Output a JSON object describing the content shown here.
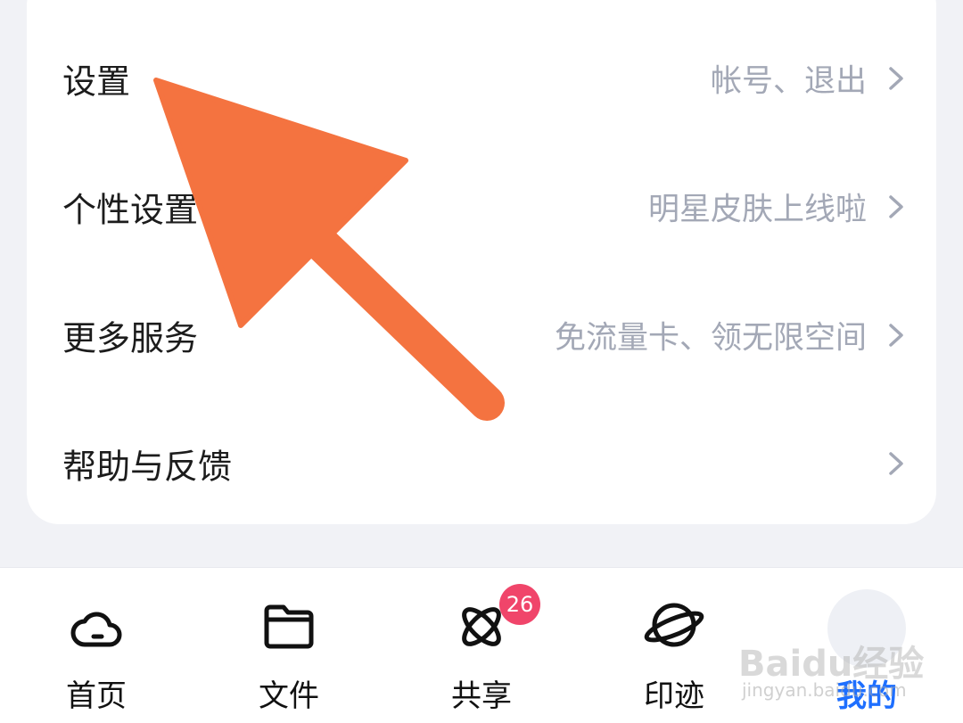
{
  "menu": {
    "items": [
      {
        "label": "设置",
        "hint": "帐号、退出"
      },
      {
        "label": "个性设置",
        "hint": "明星皮肤上线啦"
      },
      {
        "label": "更多服务",
        "hint": "免流量卡、领无限空间"
      },
      {
        "label": "帮助与反馈",
        "hint": ""
      }
    ]
  },
  "tabbar": {
    "tabs": [
      {
        "label": "首页",
        "icon": "cloud-icon"
      },
      {
        "label": "文件",
        "icon": "folder-icon"
      },
      {
        "label": "共享",
        "icon": "atom-icon",
        "badge": "26"
      },
      {
        "label": "印迹",
        "icon": "planet-icon"
      },
      {
        "label": "我的",
        "icon": "avatar",
        "active": true
      }
    ]
  },
  "watermark": {
    "brand": "Baidu经验",
    "url": "jingyan.baidu.com"
  },
  "annotation": {
    "arrow_color": "#f47340"
  },
  "colors": {
    "background": "#f1f2f6",
    "card": "#ffffff",
    "hint_text": "#a3a8b6",
    "active_tab": "#1e6fff",
    "badge": "#f0456a"
  }
}
